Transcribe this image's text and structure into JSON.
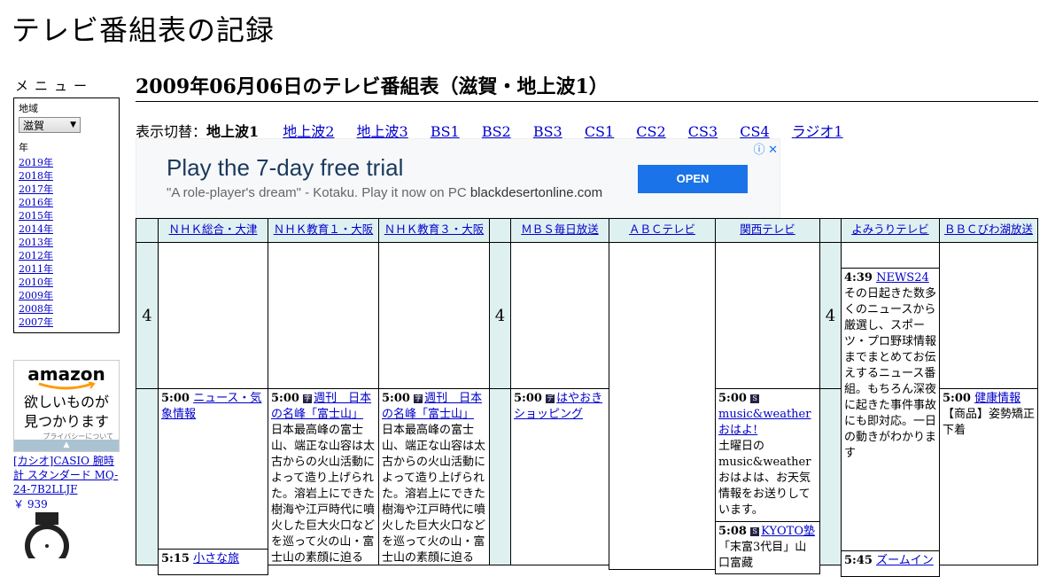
{
  "site": {
    "title": "テレビ番組表の記録"
  },
  "sidebar": {
    "menu_heading": "メニュー",
    "region_label": "地域",
    "region_value": "滋賀",
    "year_label": "年",
    "years": [
      "2019年",
      "2018年",
      "2017年",
      "2016年",
      "2015年",
      "2014年",
      "2013年",
      "2012年",
      "2011年",
      "2010年",
      "2009年",
      "2008年",
      "2007年"
    ],
    "amazon": {
      "logo": "amazon",
      "tagline_1": "欲しいものが",
      "tagline_2": "見つかります",
      "privacy": "プライバシーについて"
    },
    "product": {
      "name": "[カシオ]CASIO 腕時計 スタンダード MQ-24-7B2LLJF",
      "price": "￥ 939"
    }
  },
  "main": {
    "heading": "2009年06月06日のテレビ番組表（滋賀・地上波1）",
    "switch_label": "表示切替：",
    "current": "地上波1",
    "links": [
      "地上波2",
      "地上波3",
      "BS1",
      "BS2",
      "BS3",
      "CS1",
      "CS2",
      "CS3",
      "CS4",
      "ラジオ1"
    ]
  },
  "ad": {
    "title": "Play the 7-day free trial",
    "subtitle_quote": "\"A role-player's dream\" - Kotaku. Play it now on PC",
    "domain": "blackdesertonline.com",
    "button": "OPEN"
  },
  "channels": [
    "ＮＨＫ総合・大津",
    "ＮＨＫ教育１・大阪",
    "ＮＨＫ教育３・大阪",
    "ＭＢＳ毎日放送",
    "ＡＢＣテレビ",
    "関西テレビ",
    "よみうりテレビ",
    "ＢＢＣびわ湖放送"
  ],
  "hour_label": "4",
  "programs": {
    "nhk_sogo": {
      "time": "5:00",
      "title": "ニュース・気象情報",
      "time2": "5:15",
      "title2": "小さな旅"
    },
    "nhk_edu1": {
      "time": "5:00",
      "title": "週刊　日本の名峰「富士山」",
      "desc": "日本最高峰の富士山、端正な山容は太古からの火山活動によって造り上げられた。溶岩上にできた樹海や江戸時代に噴火した巨大火口などを巡って火の山・富士山の素顔に迫る"
    },
    "nhk_edu3": {
      "time": "5:00",
      "title": "週刊　日本の名峰「富士山」",
      "desc": "日本最高峰の富士山、端正な山容は太古からの火山活動によって造り上げられた。溶岩上にできた樹海や江戸時代に噴火した巨大火口などを巡って火の山・富士山の素顔に迫る"
    },
    "mbs": {
      "time": "5:00",
      "title": "はやおきショッピング"
    },
    "ktv": {
      "time": "5:00",
      "title": "music&weatherおはよ!",
      "desc": "土曜日のmusic&weatherおはよは、お天気情報をお送りしています。",
      "time2": "5:08",
      "title2": "KYOTO塾",
      "desc2": "「末富3代目」山口富藏"
    },
    "ytv": {
      "time": "4:39",
      "title": "NEWS24",
      "desc": "その日起きた数多くのニュースから厳選し、スポーツ・プロ野球情報までまとめてお伝えするニュース番組。もちろん深夜に起きた事件事故にも即対応。一日の動きがわかります",
      "time2": "5:45",
      "title2": "ズームイン"
    },
    "bbc": {
      "time": "5:00",
      "title": "健康情報",
      "desc": "【商品】姿勢矯正下着"
    }
  }
}
